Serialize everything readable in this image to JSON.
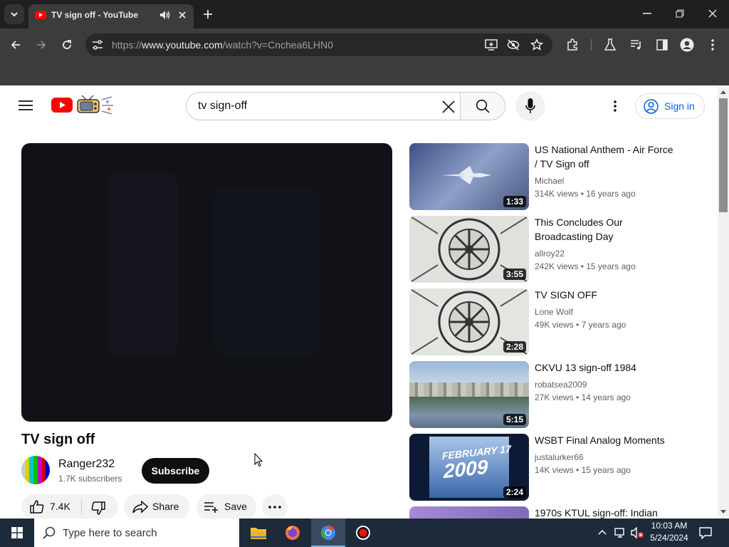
{
  "browser": {
    "tab_title": "TV sign off - YouTube",
    "url_prefix": "https://",
    "url_domain": "www.youtube.com",
    "url_path": "/watch?v=Cnchea6LHN0"
  },
  "header": {
    "search_value": "tv sign-off",
    "signin_label": "Sign in"
  },
  "video": {
    "title": "TV sign off",
    "channel": "Ranger232",
    "subscribers": "1.7K subscribers",
    "subscribe_label": "Subscribe",
    "likes": "7.4K",
    "share_label": "Share",
    "save_label": "Save"
  },
  "related": [
    {
      "title_line1": "US National Anthem - Air Force",
      "title_line2": "/ TV Sign off",
      "channel": "Michael",
      "views": "314K views",
      "age": "16 years ago",
      "duration": "1:33"
    },
    {
      "title_line1": "This Concludes Our",
      "title_line2": "Broadcasting Day",
      "channel": "allroy22",
      "views": "242K views",
      "age": "15 years ago",
      "duration": "3:55"
    },
    {
      "title_line1": "TV SIGN OFF",
      "title_line2": "",
      "channel": "Lone Wolf",
      "views": "49K views",
      "age": "7 years ago",
      "duration": "2:28"
    },
    {
      "title_line1": "CKVU 13 sign-off 1984",
      "title_line2": "",
      "channel": "robatsea2009",
      "views": "27K views",
      "age": "14 years ago",
      "duration": "5:15"
    },
    {
      "title_line1": "WSBT Final Analog Moments",
      "title_line2": "",
      "channel": "justalurker66",
      "views": "14K views",
      "age": "15 years ago",
      "duration": "2:24"
    },
    {
      "title_line1": "1970s KTUL sign-off: Indian",
      "title_line2": "",
      "channel": "",
      "views": "",
      "age": "",
      "duration": ""
    }
  ],
  "thumb_texts": {
    "wsbt_line1": "FEBRUARY 17",
    "wsbt_line2": "2009"
  },
  "taskbar": {
    "search_placeholder": "Type here to search",
    "time": "10:03 AM",
    "date": "5/24/2024"
  },
  "colors": {
    "youtube_red": "#ff0000",
    "link_blue": "#065fd4",
    "chrome_dark": "#3c3c3c"
  }
}
